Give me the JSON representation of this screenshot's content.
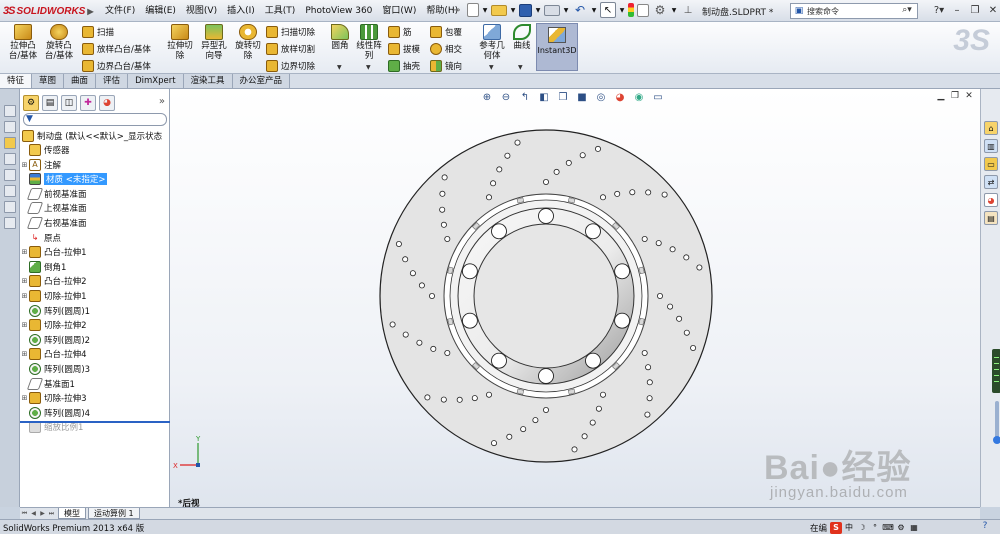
{
  "app": {
    "logo_text": "SOLIDWORKS",
    "logo_ds": "3S",
    "menus": [
      "文件(F)",
      "编辑(E)",
      "视图(V)",
      "插入(I)",
      "工具(T)",
      "PhotoView 360",
      "窗口(W)",
      "帮助(H)"
    ],
    "document_title": "制动盘.SLDPRT *",
    "search_placeholder": "搜索命令"
  },
  "ribbon": {
    "extrude_boss": "拉伸凸\n台/基体",
    "revolve_boss": "旋转凸\n台/基体",
    "sweep": "扫描",
    "loft_boss": "放样凸台/基体",
    "boundary_boss": "边界凸台/基体",
    "extrude_cut": "拉伸切\n除",
    "hole_wizard": "异型孔\n向导",
    "revolve_cut": "旋转切\n除",
    "swept_cut": "扫描切除",
    "lofted_cut": "放样切割",
    "boundary_cut": "边界切除",
    "fillet": "圆角",
    "linear_pattern": "线性阵\n列",
    "rib": "筋",
    "draft": "拔模",
    "shell": "抽壳",
    "wrap": "包覆",
    "intersect": "相交",
    "mirror": "镜向",
    "reference_geometry": "参考几\n何体",
    "curves": "曲线",
    "instant3d": "Instant3D"
  },
  "tabs": [
    "特征",
    "草图",
    "曲面",
    "评估",
    "DimXpert",
    "渲染工具",
    "办公室产品"
  ],
  "active_tab": "特征",
  "tree": {
    "root": "制动盘  (默认<<默认>_显示状态",
    "items": [
      {
        "label": "传感器",
        "icon": "sensor-icon",
        "expand": false
      },
      {
        "label": "注解",
        "icon": "annotation-icon",
        "expand": true
      },
      {
        "label": "材质 <未指定>",
        "icon": "material-icon",
        "expand": false,
        "selected": true
      },
      {
        "label": "前视基准面",
        "icon": "plane-icon",
        "expand": false
      },
      {
        "label": "上视基准面",
        "icon": "plane-icon",
        "expand": false
      },
      {
        "label": "右视基准面",
        "icon": "plane-icon",
        "expand": false
      },
      {
        "label": "原点",
        "icon": "origin-icon",
        "expand": false
      },
      {
        "label": "凸台-拉伸1",
        "icon": "extrude-icon",
        "expand": true
      },
      {
        "label": "倒角1",
        "icon": "chamfer-icon",
        "expand": false
      },
      {
        "label": "凸台-拉伸2",
        "icon": "extrude-icon",
        "expand": true
      },
      {
        "label": "切除-拉伸1",
        "icon": "cut-icon",
        "expand": true
      },
      {
        "label": "阵列(圆周)1",
        "icon": "pattern-icon",
        "expand": false
      },
      {
        "label": "切除-拉伸2",
        "icon": "cut-icon",
        "expand": true
      },
      {
        "label": "阵列(圆周)2",
        "icon": "pattern-icon",
        "expand": false
      },
      {
        "label": "凸台-拉伸4",
        "icon": "extrude-icon",
        "expand": true
      },
      {
        "label": "阵列(圆周)3",
        "icon": "pattern-icon",
        "expand": false
      },
      {
        "label": "基准面1",
        "icon": "plane-icon",
        "expand": false
      },
      {
        "label": "切除-拉伸3",
        "icon": "cut-icon",
        "expand": true
      },
      {
        "label": "阵列(圆周)4",
        "icon": "pattern-icon",
        "expand": false
      },
      {
        "label": "缩放比例1",
        "icon": "scale-icon",
        "expand": false,
        "dim": true
      }
    ]
  },
  "viewport": {
    "view_name": "*后视",
    "axis_x": "X",
    "axis_y": "Y"
  },
  "bottom_tabs": [
    "模型",
    "运动算例 1"
  ],
  "status": {
    "text": "SolidWorks Premium 2013 x64 版",
    "ime_label": "在编",
    "ime_chars": [
      "S",
      "中",
      "☽",
      "°",
      "⌨"
    ]
  },
  "watermark": {
    "word": "Bai●经验",
    "url": "jingyan.baidu.com"
  },
  "colors": {
    "accent": "#2a62c4",
    "selection": "#3399ff",
    "instant3d_bg": "#aeb9d3",
    "logo_red": "#c8141e"
  }
}
